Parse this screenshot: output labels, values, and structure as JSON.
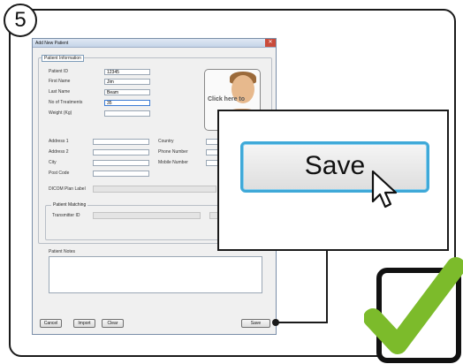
{
  "step": {
    "number": "5"
  },
  "window": {
    "title": "Add New Patient",
    "close_glyph": "✕"
  },
  "patient_info": {
    "group_label": "Patient Information",
    "fields": {
      "patient_id": {
        "label": "Patient ID",
        "value": "12345"
      },
      "first_name": {
        "label": "First Name",
        "value": "Jim"
      },
      "last_name": {
        "label": "Last Name",
        "value": "Beam"
      },
      "no_treatments": {
        "label": "No of Treatments",
        "value": "35"
      },
      "weight": {
        "label": "Weight (Kg)",
        "value": ""
      }
    },
    "photo_prompt": "Click here to"
  },
  "address": {
    "address1": {
      "label": "Address 1",
      "value": ""
    },
    "address2": {
      "label": "Address 2",
      "value": ""
    },
    "city": {
      "label": "City",
      "value": ""
    },
    "post_code": {
      "label": "Post Code",
      "value": ""
    },
    "country": {
      "label": "Country",
      "value": ""
    },
    "phone": {
      "label": "Phone Number",
      "value": ""
    },
    "mobile": {
      "label": "Mobile Number",
      "value": ""
    }
  },
  "dicom": {
    "label": "DICOM Plan Label",
    "value": ""
  },
  "matching": {
    "group_label": "Patient Matching",
    "transmitter_label": "Transmitter ID",
    "transmitter_value": ""
  },
  "notes": {
    "label": "Patient Notes",
    "value": ""
  },
  "buttons": {
    "cancel": "Cancel",
    "import": "Import",
    "clear": "Clear",
    "save": "Save"
  },
  "callout": {
    "save_label": "Save"
  },
  "colors": {
    "accent_blue": "#3fa9d8",
    "check_green": "#7cbb2b"
  }
}
